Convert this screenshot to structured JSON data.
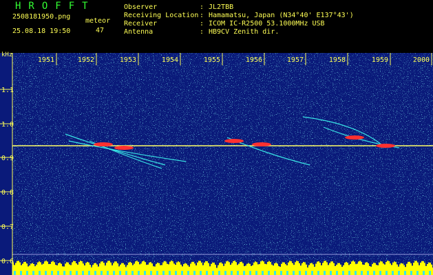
{
  "app": {
    "title": "HROFFT",
    "file_name": "2508181950.png",
    "datetime": "25.08.18 19:50"
  },
  "meteor": {
    "label": "meteor",
    "count": "47"
  },
  "station": [
    {
      "label": "Observer",
      "value": "JL2TBB"
    },
    {
      "label": "Receiving Location",
      "value": "Hamamatsu, Japan (N34°40' E137°43')"
    },
    {
      "label": "Receiver",
      "value": "ICOM IC-R2500 53.1000MHz USB"
    },
    {
      "label": "Antenna",
      "value": "HB9CV Zenith dir."
    }
  ],
  "colon": ":",
  "axis": {
    "unit": "kHz",
    "freq_ticks": [
      "1.1",
      "1.0",
      "0.9",
      "0.8",
      "0.7",
      "0.6"
    ],
    "time_ticks": [
      "1951",
      "1952",
      "1953",
      "1954",
      "1955",
      "1956",
      "1957",
      "1958",
      "1959",
      "2000"
    ]
  },
  "colors": {
    "text_primary": "#ffff55",
    "title": "#33ff33",
    "background": "#0a1a7a",
    "noise_cyan": "#39e6e6",
    "carrier": "#ffff66",
    "echo_red": "#ff3030",
    "level": "#ffff00"
  }
}
